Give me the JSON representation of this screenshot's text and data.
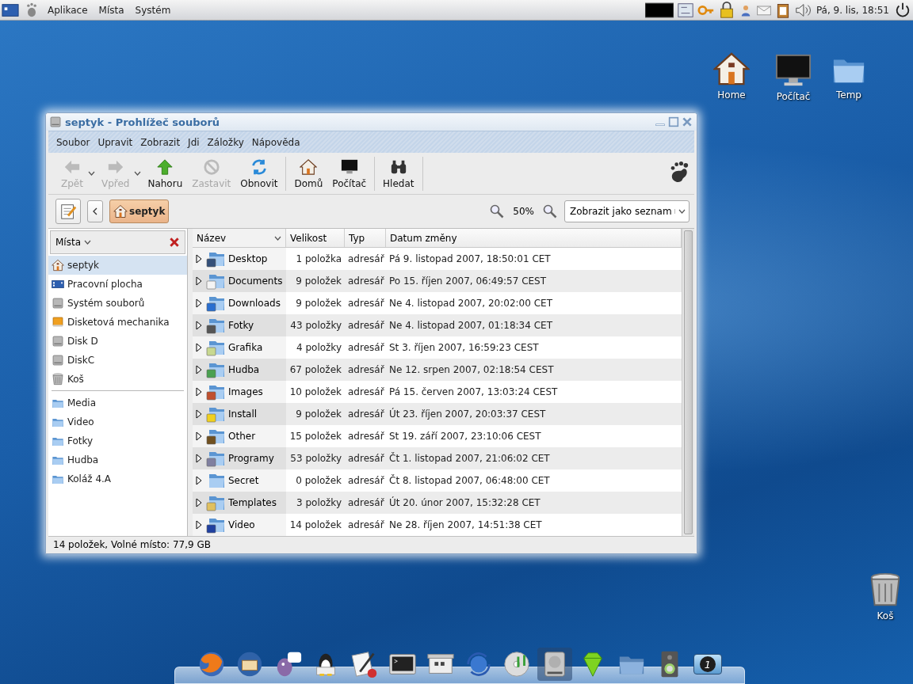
{
  "top_panel": {
    "menus": [
      "Aplikace",
      "Místa",
      "Systém"
    ],
    "clock": "Pá, 9. lis, 18:51"
  },
  "desktop_icons": [
    {
      "label": "Home"
    },
    {
      "label": "Počítač"
    },
    {
      "label": "Temp"
    },
    {
      "label": "Koš"
    }
  ],
  "window": {
    "title": "septyk - Prohlížeč souborů",
    "menu": [
      "Soubor",
      "Upravit",
      "Zobrazit",
      "Jdi",
      "Záložky",
      "Nápověda"
    ],
    "toolbar": [
      [
        {
          "label": "Zpět",
          "disabled": true,
          "dropdown": true
        },
        {
          "label": "Vpřed",
          "disabled": true,
          "dropdown": true
        },
        {
          "label": "Nahoru",
          "disabled": false,
          "dropdown": false
        },
        {
          "label": "Zastavit",
          "disabled": true,
          "dropdown": false
        },
        {
          "label": "Obnovit",
          "disabled": false,
          "dropdown": false
        }
      ],
      [
        {
          "label": "Domů",
          "disabled": false,
          "dropdown": false
        },
        {
          "label": "Počítač",
          "disabled": false,
          "dropdown": false
        }
      ],
      [
        {
          "label": "Hledat",
          "disabled": false,
          "dropdown": false
        }
      ]
    ],
    "location": {
      "path": [
        {
          "label": "septyk",
          "selected": true
        }
      ],
      "zoom": "50%",
      "view": "Zobrazit jako seznam"
    },
    "sidebar": {
      "title": "Místa",
      "places": [
        {
          "label": "septyk",
          "selected": true
        },
        {
          "label": "Pracovní plocha",
          "selected": false
        },
        {
          "label": "Systém souborů",
          "selected": false
        },
        {
          "label": "Disketová mechanika",
          "selected": false
        },
        {
          "label": "Disk D",
          "selected": false
        },
        {
          "label": "DiskC",
          "selected": false
        },
        {
          "label": "Koš",
          "selected": false
        }
      ],
      "bookmarks": [
        {
          "label": "Media",
          "selected": false
        },
        {
          "label": "Video",
          "selected": false
        },
        {
          "label": "Fotky",
          "selected": false
        },
        {
          "label": "Hudba",
          "selected": false
        },
        {
          "label": "Koláž 4.A",
          "selected": false
        }
      ]
    },
    "table": {
      "columns": [
        {
          "label": "Název",
          "sorted": true
        },
        {
          "label": "Velikost",
          "sorted": false
        },
        {
          "label": "Typ",
          "sorted": false
        },
        {
          "label": "Datum změny",
          "sorted": false
        }
      ],
      "rows": [
        {
          "name": "Desktop",
          "size": "1 položka",
          "type": "adresář",
          "date": "Pá 9. listopad 2007, 18:50:01 CET",
          "expanded": false
        },
        {
          "name": "Documents",
          "size": "9 položek",
          "type": "adresář",
          "date": "Po 15. říjen 2007, 06:49:57 CEST",
          "expanded": false
        },
        {
          "name": "Downloads",
          "size": "9 položek",
          "type": "adresář",
          "date": "Ne 4. listopad 2007, 20:02:00 CET",
          "expanded": false
        },
        {
          "name": "Fotky",
          "size": "43 položky",
          "type": "adresář",
          "date": "Ne 4. listopad 2007, 01:18:34 CET",
          "expanded": false
        },
        {
          "name": "Grafika",
          "size": "4 položky",
          "type": "adresář",
          "date": "St 3. říjen 2007, 16:59:23 CEST",
          "expanded": false
        },
        {
          "name": "Hudba",
          "size": "67 položek",
          "type": "adresář",
          "date": "Ne 12. srpen 2007, 02:18:54 CEST",
          "expanded": false
        },
        {
          "name": "Images",
          "size": "10 položek",
          "type": "adresář",
          "date": "Pá 15. červen 2007, 13:03:24 CEST",
          "expanded": false
        },
        {
          "name": "Install",
          "size": "9 položek",
          "type": "adresář",
          "date": "Út 23. říjen 2007, 20:03:37 CEST",
          "expanded": false
        },
        {
          "name": "Other",
          "size": "15 položek",
          "type": "adresář",
          "date": "St 19. září 2007, 23:10:06 CEST",
          "expanded": false
        },
        {
          "name": "Programy",
          "size": "53 položky",
          "type": "adresář",
          "date": "Čt 1. listopad 2007, 21:06:02 CET",
          "expanded": false
        },
        {
          "name": "Secret",
          "size": "0 položek",
          "type": "adresář",
          "date": "Čt 8. listopad 2007, 06:48:00 CET",
          "expanded": false
        },
        {
          "name": "Templates",
          "size": "3 položky",
          "type": "adresář",
          "date": "Út 20. únor 2007, 15:32:28 CET",
          "expanded": false
        },
        {
          "name": "Video",
          "size": "14 položek",
          "type": "adresář",
          "date": "Ne 28. říjen 2007, 14:51:38 CET",
          "expanded": false
        }
      ]
    },
    "status_bar": "14 položek, Volné místo: 77,9 GB"
  },
  "dock": {
    "items": [
      {
        "selected": false
      },
      {
        "selected": false
      },
      {
        "selected": false
      },
      {
        "selected": false
      },
      {
        "selected": false
      },
      {
        "selected": false
      },
      {
        "selected": false
      },
      {
        "selected": false
      },
      {
        "selected": false
      },
      {
        "selected": true
      },
      {
        "selected": false
      },
      {
        "selected": false
      },
      {
        "selected": false
      },
      {
        "selected": false
      }
    ],
    "workspace": "1"
  }
}
